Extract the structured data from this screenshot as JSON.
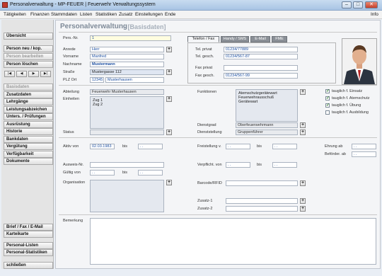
{
  "window": {
    "title": "Personalverwaltung - MP-FEUER | Feuerwehr Verwaltungssystem",
    "info": "Info"
  },
  "menu": [
    "Tätigkeiten",
    "Finanzen",
    "Stammdaten",
    "Listen",
    "Statistiken",
    "Zusatz",
    "Einstellungen",
    "Ende"
  ],
  "sidebar": {
    "overview": "Übersicht",
    "new_copy": "Person neu / kop.",
    "edit": "Person bearbeiten",
    "delete": "Person löschen",
    "nav": [
      "|◀",
      "◀",
      "▶",
      "▶|"
    ],
    "sections": [
      {
        "label": "Basisdaten",
        "disabled": true
      },
      {
        "label": "Zusatzdaten",
        "disabled": false
      },
      {
        "label": "Lehrgänge",
        "disabled": false
      },
      {
        "label": "Leistungsabzeichen",
        "disabled": false
      },
      {
        "label": "Unters. / Prüfungen",
        "disabled": false
      },
      {
        "label": "Ausrüstung",
        "disabled": false
      },
      {
        "label": "Historie",
        "disabled": false
      },
      {
        "label": "Bankdaten",
        "disabled": false
      },
      {
        "label": "Vergütung",
        "disabled": false
      },
      {
        "label": "Verfügbarkeit",
        "disabled": false
      },
      {
        "label": "Dokumente",
        "disabled": false
      }
    ],
    "letter": "Brief / Fax / E-Mail",
    "card": "Karteikarte",
    "lists": "Personal-Listen",
    "stats": "Personal-Statistiken",
    "close": "schließen"
  },
  "header": {
    "title": "Personalverwaltung",
    "subtitle": "- [Basisdaten]"
  },
  "person": {
    "nr_label": "Pers.-Nr.",
    "nr": "1",
    "salutation_label": "Anrede",
    "salutation": "Herr",
    "firstname_label": "Vorname",
    "firstname": "Manfred",
    "lastname_label": "Nachname",
    "lastname": "Mustermann",
    "street_label": "Straße",
    "street": "Mustergasse 112",
    "zip_label": "PLZ Ort",
    "zip": "12345",
    "city": "Musterhausen"
  },
  "contact_tabs": [
    "Telefon / Fax",
    "Handy / SMS",
    "E-Mail",
    "FME"
  ],
  "contact": {
    "tel_private_label": "Tel. privat",
    "tel_private": "01234/77889",
    "tel_business_label": "Tel. gesch.",
    "tel_business": "01234/567-87",
    "fax_private_label": "Fax privat",
    "fax_private": "",
    "fax_business_label": "Fax gesch.",
    "fax_business": "01234/567-99"
  },
  "unit": {
    "department_label": "Abteilung",
    "department": "Feuerwehr Musterhausen",
    "units_label": "Einheiten",
    "units": [
      "Zug 1",
      "Zug 2"
    ],
    "status_label": "Status",
    "status": "",
    "functions_label": "Funktionen",
    "functions": [
      "Atemschutzgerätewart",
      "Feuerwehrausschuß",
      "Gerätewart"
    ],
    "rank_label": "Dienstgrad",
    "rank": "Oberfeuerwehrmann",
    "position_label": "Dienststellung",
    "position": "Gruppenführer"
  },
  "fitness": [
    {
      "label": "tauglich f. Einsatz",
      "checked": true
    },
    {
      "label": "tauglich f. Atemschutz",
      "checked": true
    },
    {
      "label": "tauglich f. Übung",
      "checked": true
    },
    {
      "label": "tauglich f. Ausbildung",
      "checked": false
    }
  ],
  "dates": {
    "active_label": "Aktiv von",
    "active_from": "02.03.1983",
    "bis": "bis",
    "active_to": ". .",
    "exempt_label": "Freistellung v.",
    "exempt_from": ". .",
    "exempt_to": ". .",
    "honor_label": "Ehrung ab",
    "honor": ". .",
    "promotion_label": "Beförder. ab",
    "promotion": ". .",
    "id_label": "Ausweis-Nr.",
    "id_nr": "",
    "valid_label": "Gültig von",
    "valid_from": ". .",
    "valid_to": ". .",
    "duty_label": "Verpflicht. von",
    "duty_from": ". .",
    "duty_to": ". .",
    "org_label": "Organisation",
    "barcode_label": "Barcode/RFID",
    "extra1_label": "Zusatz-1",
    "extra2_label": "Zusatz-2"
  },
  "remarks_label": "Bemerkung"
}
